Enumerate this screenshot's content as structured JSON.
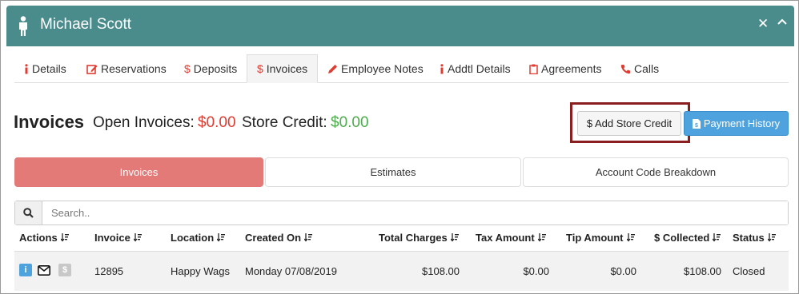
{
  "header": {
    "title": "Michael Scott"
  },
  "tabs": [
    {
      "icon": "info-icon",
      "label": "Details"
    },
    {
      "icon": "edit-icon",
      "label": "Reservations"
    },
    {
      "icon": "dollar-icon",
      "label": "Deposits"
    },
    {
      "icon": "dollar-icon",
      "label": "Invoices",
      "active": true
    },
    {
      "icon": "pencil-icon",
      "label": "Employee Notes"
    },
    {
      "icon": "info-icon",
      "label": "Addtl Details"
    },
    {
      "icon": "clipboard-icon",
      "label": "Agreements"
    },
    {
      "icon": "phone-icon",
      "label": "Calls"
    }
  ],
  "summary": {
    "title": "Invoices",
    "open_label": "Open Invoices:",
    "open_value": "$0.00",
    "credit_label": "Store Credit:",
    "credit_value": "$0.00"
  },
  "buttons": {
    "add_store_credit": "$ Add Store Credit",
    "payment_history": "Payment History"
  },
  "segments": [
    "Invoices",
    "Estimates",
    "Account Code Breakdown"
  ],
  "search": {
    "placeholder": "Search.."
  },
  "table": {
    "columns": [
      "Actions",
      "Invoice",
      "Location",
      "Created On",
      "Total Charges",
      "Tax Amount",
      "Tip Amount",
      "$ Collected",
      "Status"
    ],
    "rows": [
      {
        "invoice": "12895",
        "location": "Happy Wags",
        "created_on": "Monday 07/08/2019",
        "total_charges": "$108.00",
        "tax_amount": "$0.00",
        "tip_amount": "$0.00",
        "collected": "$108.00",
        "status": "Closed"
      }
    ]
  },
  "colors": {
    "header": "#4a8c8c",
    "accent_red": "#e03c31",
    "credit_green": "#4cae4c",
    "active_segment": "#e47a78",
    "payment_blue": "#4ea3df"
  }
}
